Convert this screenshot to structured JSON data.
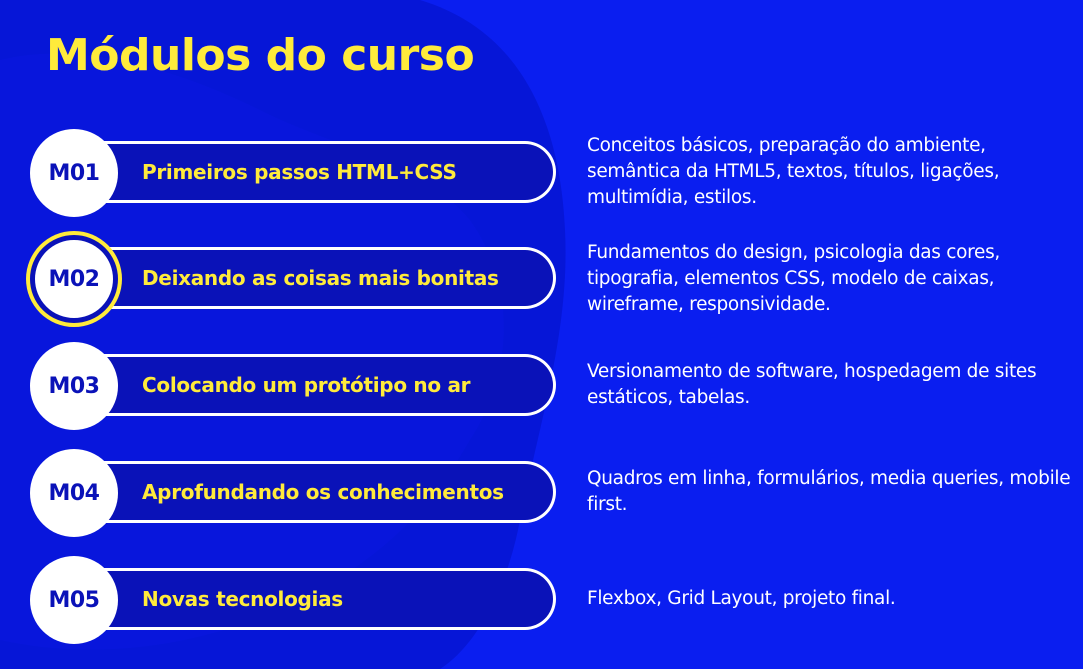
{
  "page": {
    "title": "Módulos do curso"
  },
  "colors": {
    "background": "#0a1ef0",
    "accent": "#ffeb3b",
    "pill": "#0a12b8",
    "badge": "#ffffff"
  },
  "modules": [
    {
      "code": "M01",
      "title": "Primeiros passos HTML+CSS",
      "description": "Conceitos básicos, preparação do ambiente, semântica da HTML5, textos, títulos, ligações, multimídia, estilos.",
      "highlighted": false
    },
    {
      "code": "M02",
      "title": "Deixando as coisas mais bonitas",
      "description": "Fundamentos do design, psicologia das cores, tipografia, elementos CSS, modelo de caixas, wireframe, responsividade.",
      "highlighted": true
    },
    {
      "code": "M03",
      "title": "Colocando um protótipo no ar",
      "description": "Versionamento de software, hospedagem de sites estáticos, tabelas.",
      "highlighted": false
    },
    {
      "code": "M04",
      "title": "Aprofundando os conhecimentos",
      "description": "Quadros em linha, formulários, media queries, mobile first.",
      "highlighted": false
    },
    {
      "code": "M05",
      "title": "Novas tecnologias",
      "description": "Flexbox, Grid Layout, projeto final.",
      "highlighted": false
    }
  ]
}
